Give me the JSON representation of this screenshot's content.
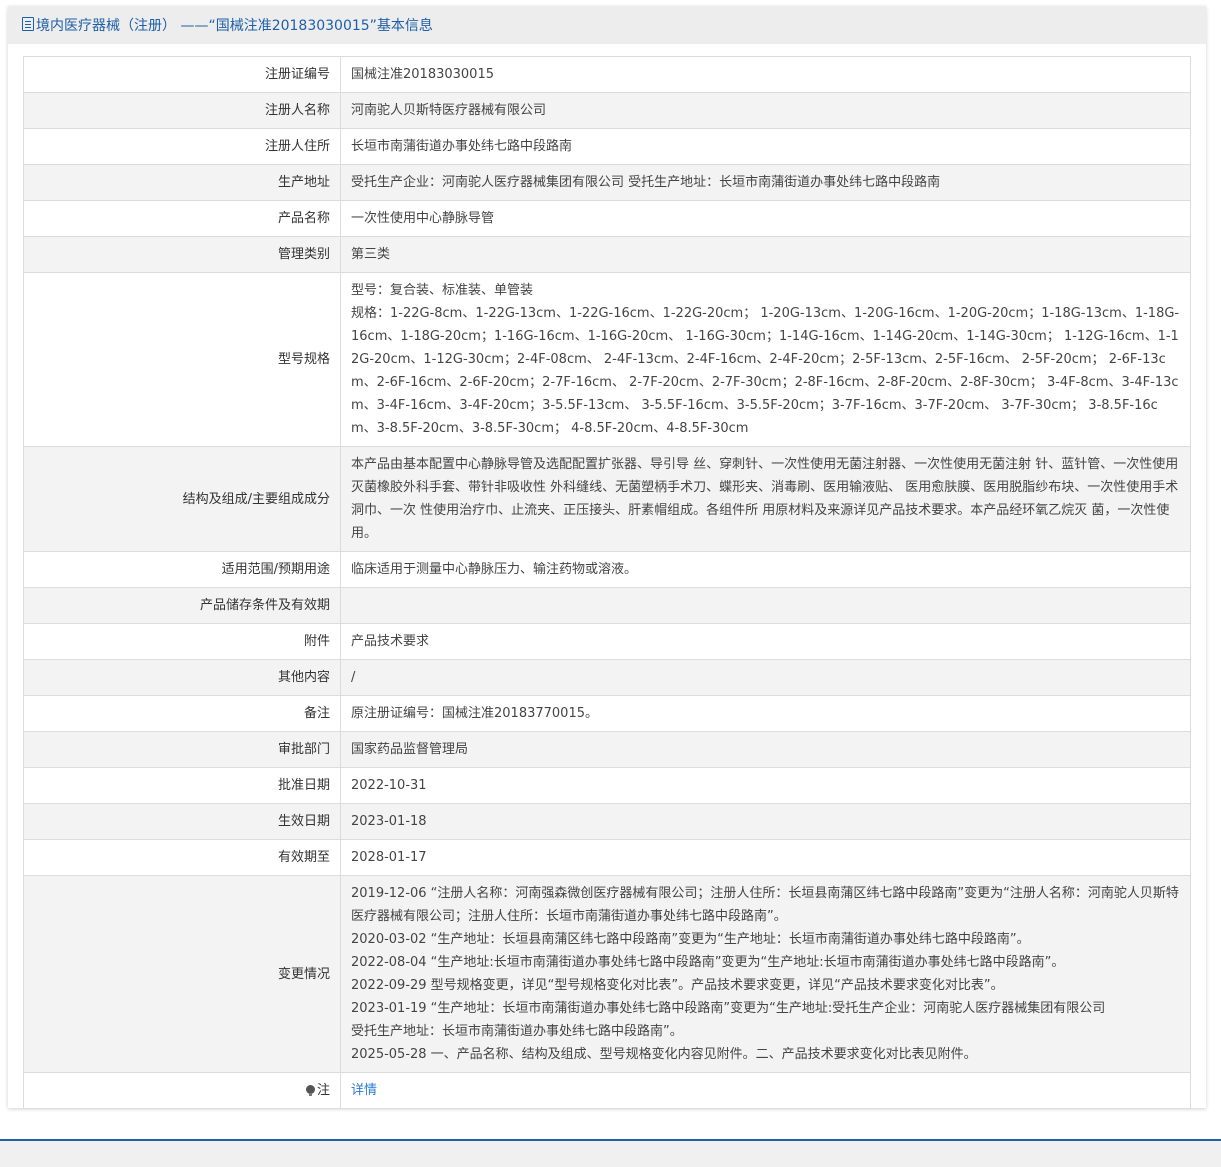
{
  "header": {
    "title": "境内医疗器械（注册）  ——“国械注准20183030015”基本信息",
    "accent_color": "#1e5fa8"
  },
  "rows": [
    {
      "label": "注册证编号",
      "lines": [
        "国械注准20183030015"
      ]
    },
    {
      "label": "注册人名称",
      "lines": [
        "河南驼人贝斯特医疗器械有限公司"
      ]
    },
    {
      "label": "注册人住所",
      "lines": [
        "长垣市南蒲街道办事处纬七路中段路南"
      ]
    },
    {
      "label": "生产地址",
      "lines": [
        "受托生产企业：河南驼人医疗器械集团有限公司 受托生产地址：长垣市南蒲街道办事处纬七路中段路南"
      ]
    },
    {
      "label": "产品名称",
      "lines": [
        "一次性使用中心静脉导管"
      ]
    },
    {
      "label": "管理类别",
      "lines": [
        "第三类"
      ]
    },
    {
      "label": "型号规格",
      "lines": [
        "型号：复合装、标准装、单管装",
        "规格：1-22G-8cm、1-22G-13cm、1-22G-16cm、1-22G-20cm； 1-20G-13cm、1-20G-16cm、1-20G-20cm；1-18G-13cm、1-18G-16cm、1-18G-20cm；1-16G-16cm、1-16G-20cm、 1-16G-30cm；1-14G-16cm、1-14G-20cm、1-14G-30cm； 1-12G-16cm、1-12G-20cm、1-12G-30cm；2-4F-08cm、 2-4F-13cm、2-4F-16cm、2-4F-20cm；2-5F-13cm、2-5F-16cm、 2-5F-20cm； 2-6F-13cm、2-6F-16cm、2-6F-20cm；2-7F-16cm、 2-7F-20cm、2-7F-30cm；2-8F-16cm、2-8F-20cm、2-8F-30cm； 3-4F-8cm、3-4F-13cm、3-4F-16cm、3-4F-20cm；3-5.5F-13cm、 3-5.5F-16cm、3-5.5F-20cm；3-7F-16cm、3-7F-20cm、 3-7F-30cm； 3-8.5F-16cm、3-8.5F-20cm、3-8.5F-30cm； 4-8.5F-20cm、4-8.5F-30cm"
      ]
    },
    {
      "label": "结构及组成/主要组成成分",
      "lines": [
        "本产品由基本配置中心静脉导管及选配配置扩张器、导引导 丝、穿刺针、一次性使用无菌注射器、一次性使用无菌注射 针、蓝针管、一次性使用灭菌橡胶外科手套、带针非吸收性 外科缝线、无菌塑柄手术刀、蝶形夹、消毒刷、医用输液贴、 医用愈肤膜、医用脱脂纱布块、一次性使用手术洞巾、一次 性使用治疗巾、止流夹、正压接头、肝素帽组成。各组件所 用原材料及来源详见产品技术要求。本产品经环氧乙烷灭 菌，一次性使用。"
      ]
    },
    {
      "label": "适用范围/预期用途",
      "lines": [
        "临床适用于测量中心静脉压力、输注药物或溶液。"
      ]
    },
    {
      "label": "产品储存条件及有效期",
      "lines": [
        ""
      ]
    },
    {
      "label": "附件",
      "lines": [
        "产品技术要求"
      ]
    },
    {
      "label": "其他内容",
      "lines": [
        "/"
      ]
    },
    {
      "label": "备注",
      "lines": [
        "原注册证编号：国械注准20183770015。"
      ]
    },
    {
      "label": "审批部门",
      "lines": [
        "国家药品监督管理局"
      ]
    },
    {
      "label": "批准日期",
      "lines": [
        "2022-10-31"
      ]
    },
    {
      "label": "生效日期",
      "lines": [
        "2023-01-18"
      ]
    },
    {
      "label": "有效期至",
      "lines": [
        "2028-01-17"
      ]
    },
    {
      "label": "变更情况",
      "lines": [
        "2019-12-06 “注册人名称：河南强森微创医疗器械有限公司；注册人住所：长垣县南蒲区纬七路中段路南”变更为“注册人名称：河南驼人贝斯特医疗器械有限公司；注册人住所：长垣市南蒲街道办事处纬七路中段路南”。",
        "2020-03-02 “生产地址：长垣县南蒲区纬七路中段路南”变更为“生产地址：长垣市南蒲街道办事处纬七路中段路南”。",
        "2022-08-04 “生产地址:长垣市南蒲街道办事处纬七路中段路南”变更为“生产地址:长垣市南蒲街道办事处纬七路中段路南”。",
        "2022-09-29 型号规格变更，详见“型号规格变化对比表”。产品技术要求变更，详见“产品技术要求变化对比表”。",
        "2023-01-19 “生产地址：长垣市南蒲街道办事处纬七路中段路南”变更为“生产地址:受托生产企业：河南驼人医疗器械集团有限公司",
        "受托生产地址：长垣市南蒲街道办事处纬七路中段路南”。",
        "2025-05-28 一、产品名称、结构及组成、型号规格变化内容见附件。二、产品技术要求变化对比表见附件。"
      ]
    }
  ],
  "note_row": {
    "label": "注",
    "icon": "lightbulb-icon",
    "link_text": "详情",
    "link_color": "#2a7bd4"
  }
}
